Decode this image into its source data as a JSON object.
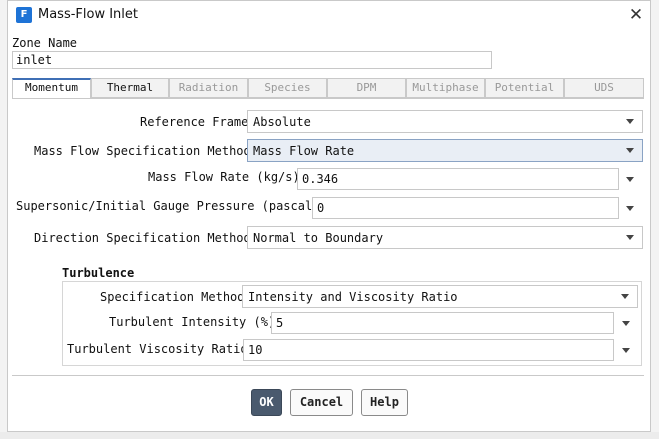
{
  "window": {
    "title": "Mass-Flow Inlet",
    "icon_letter": "F",
    "close_glyph": "✕"
  },
  "zone": {
    "label": "Zone Name",
    "value": "inlet"
  },
  "tabs": [
    {
      "label": "Momentum"
    },
    {
      "label": "Thermal"
    },
    {
      "label": "Radiation"
    },
    {
      "label": "Species"
    },
    {
      "label": "DPM"
    },
    {
      "label": "Multiphase"
    },
    {
      "label": "Potential"
    },
    {
      "label": "UDS"
    }
  ],
  "momentum": {
    "reference_frame": {
      "label": "Reference Frame",
      "value": "Absolute"
    },
    "mass_flow_spec_method": {
      "label": "Mass Flow Specification Method",
      "value": "Mass Flow Rate"
    },
    "mass_flow_rate": {
      "label": "Mass Flow Rate (kg/s)",
      "value": "0.346"
    },
    "gauge_pressure": {
      "label": "Supersonic/Initial Gauge Pressure (pascal)",
      "value": "0"
    },
    "direction_spec_method": {
      "label": "Direction Specification Method",
      "value": "Normal to Boundary"
    }
  },
  "turbulence": {
    "title": "Turbulence",
    "spec_method": {
      "label": "Specification Method",
      "value": "Intensity and Viscosity Ratio"
    },
    "intensity": {
      "label": "Turbulent Intensity (%)",
      "value": "5"
    },
    "viscosity_ratio": {
      "label": "Turbulent Viscosity Ratio",
      "value": "10"
    }
  },
  "buttons": {
    "ok": "OK",
    "cancel": "Cancel",
    "help": "Help"
  },
  "colors": {
    "accent": "#3f6fb5",
    "primary_button": "#4a5a6e",
    "title_icon": "#1e73d6"
  }
}
